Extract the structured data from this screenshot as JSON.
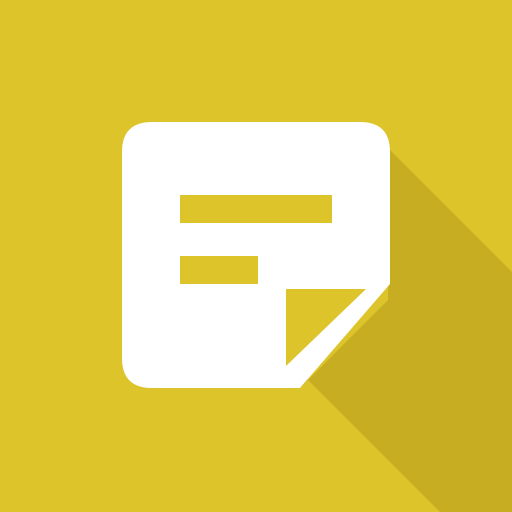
{
  "icon": {
    "name": "sticky-note-icon",
    "background_color": "#DDC42A",
    "shadow_color": "#C6AD21",
    "note_color": "#FFFFFF",
    "line_color": "#DDC42A",
    "fold_color": "#DDC42A"
  }
}
